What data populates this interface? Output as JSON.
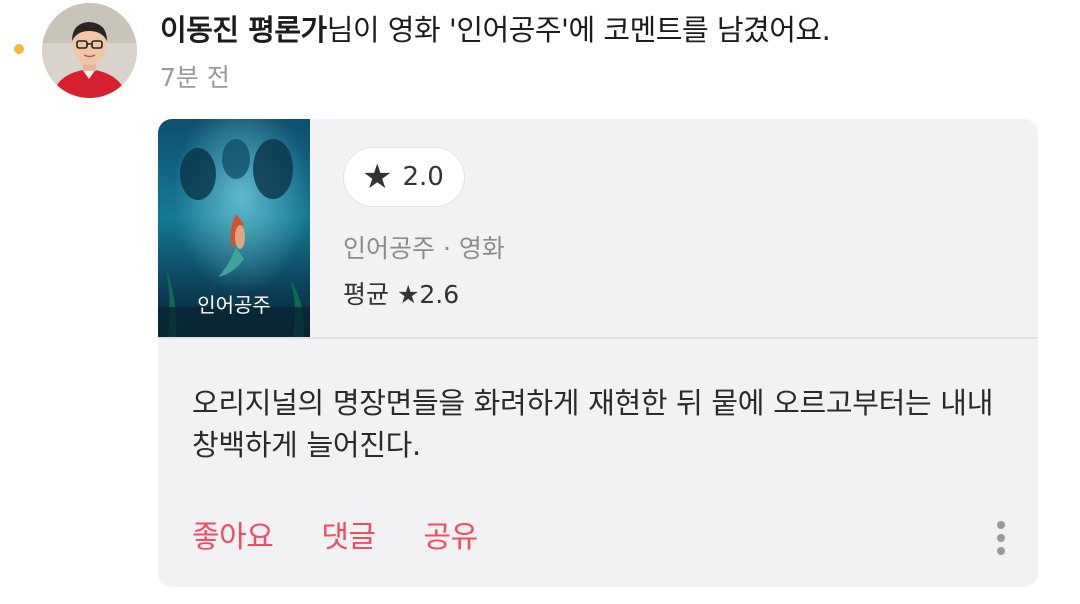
{
  "feed_item": {
    "author_name": "이동진 평론가",
    "headline_rest": "님이 영화 '인어공주'에 코멘트를 남겼어요.",
    "time_ago": "7분 전",
    "unread_color": "#f5b83d"
  },
  "card": {
    "user_rating_icon": "star-icon",
    "user_rating": "2.0",
    "movie_meta": "인어공주 · 영화",
    "average_label": "평균 ★2.6",
    "poster_title": "인어공주",
    "comment_text": "오리지널의 명장면들을 화려하게 재현한 뒤 뭍에 오르고부터는 내내 창백하게 늘어진다.",
    "actions": {
      "like": "좋아요",
      "comment": "댓글",
      "share": "공유"
    },
    "accent_color": "#ef4d65"
  }
}
